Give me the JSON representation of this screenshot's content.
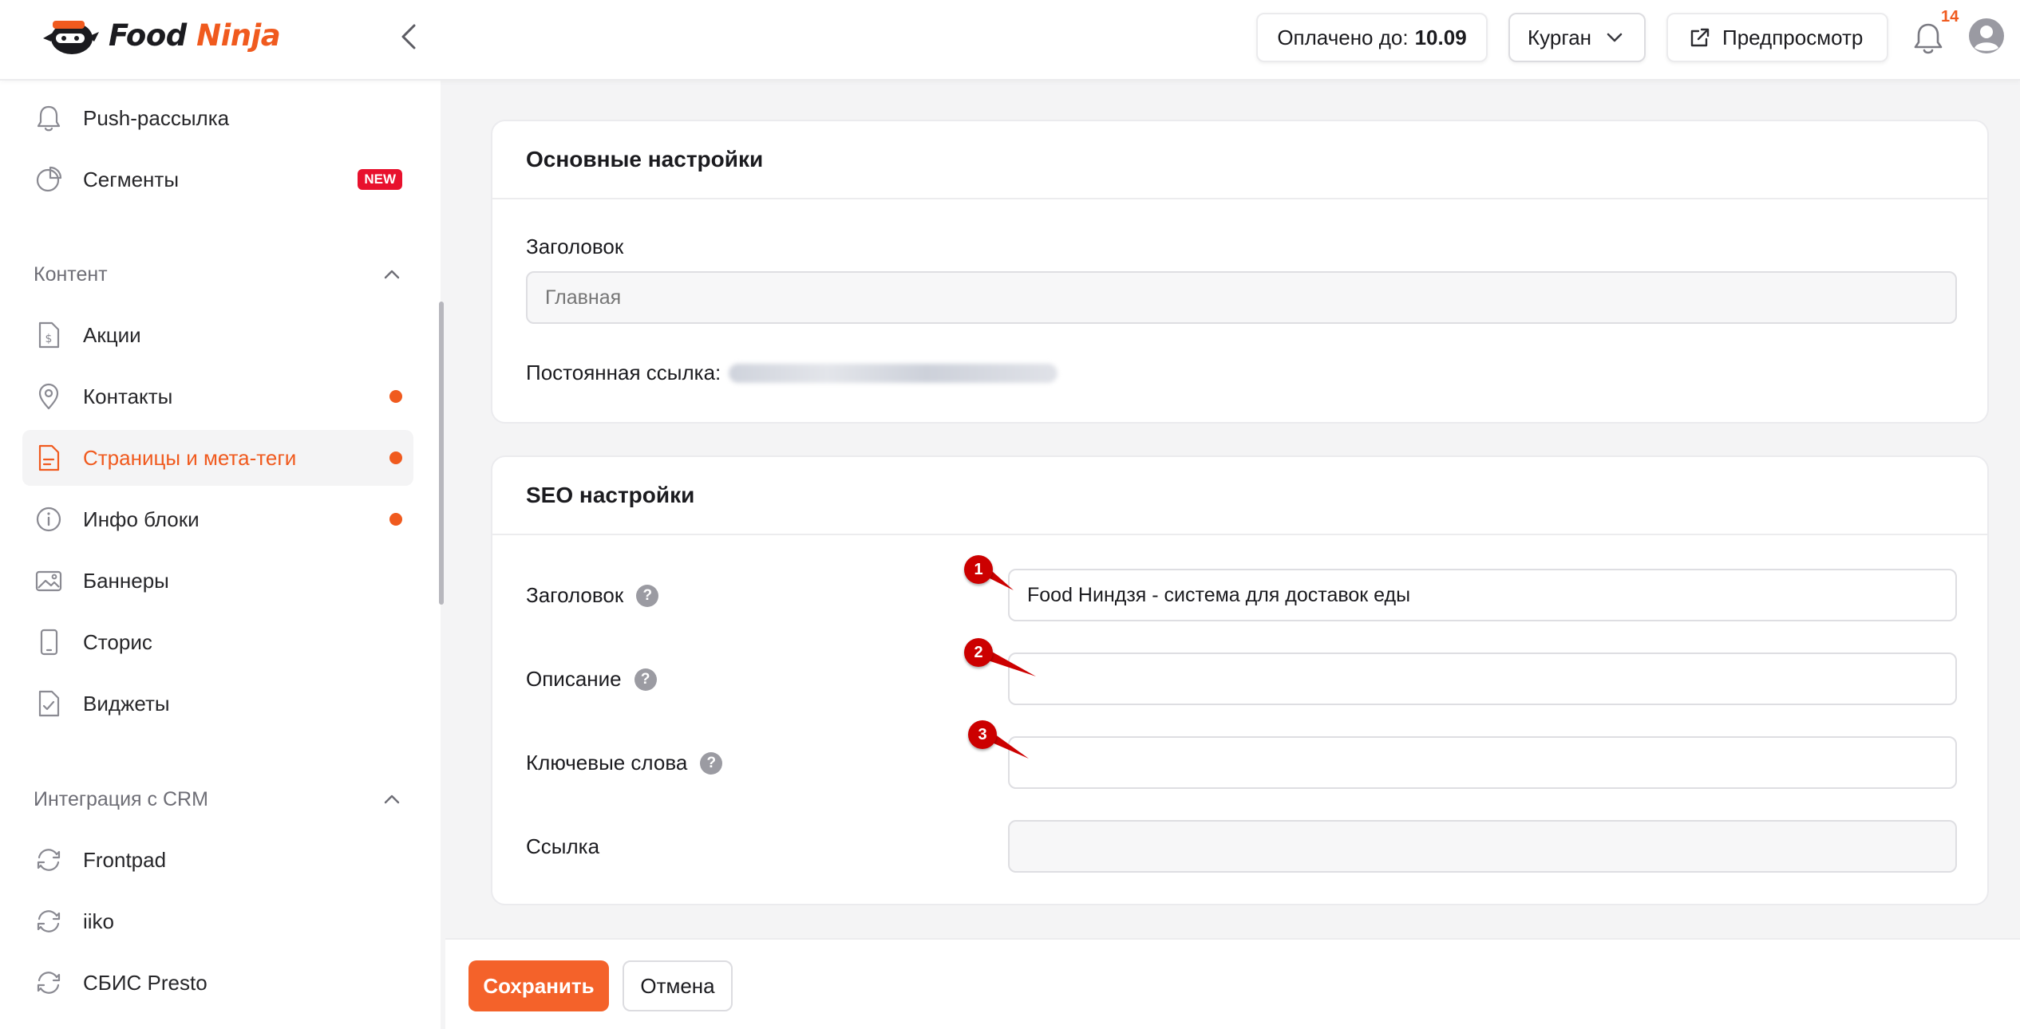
{
  "brand": {
    "food": "Food",
    "ninja": "Ninja"
  },
  "header": {
    "paid_label": "Оплачено до:",
    "paid_date": "10.09",
    "city": "Курган",
    "preview_label": "Предпросмотр",
    "notifications_count": "14"
  },
  "sidebar": {
    "items_top": [
      {
        "label": "Push-рассылка",
        "icon": "bell-icon"
      },
      {
        "label": "Сегменты",
        "icon": "pie-chart-icon",
        "badge": "NEW"
      }
    ],
    "content_section": "Контент",
    "content_items": [
      {
        "label": "Акции",
        "icon": "dollar-file-icon"
      },
      {
        "label": "Контакты",
        "icon": "map-pin-icon"
      },
      {
        "label": "Страницы и мета-теги",
        "icon": "document-icon"
      },
      {
        "label": "Инфо блоки",
        "icon": "info-icon"
      },
      {
        "label": "Баннеры",
        "icon": "image-icon"
      },
      {
        "label": "Сторис",
        "icon": "phone-icon"
      },
      {
        "label": "Виджеты",
        "icon": "check-file-icon"
      }
    ],
    "crm_section": "Интеграция с CRM",
    "crm_items": [
      {
        "label": "Frontpad",
        "icon": "sync-icon"
      },
      {
        "label": "iiko",
        "icon": "sync-icon"
      },
      {
        "label": "СБИС Presto",
        "icon": "sync-icon"
      }
    ]
  },
  "main_settings": {
    "title": "Основные настройки",
    "heading_label": "Заголовок",
    "heading_placeholder": "Главная",
    "permalink_label": "Постоянная ссылка:"
  },
  "seo_settings": {
    "title": "SEO настройки",
    "fields": [
      {
        "label": "Заголовок",
        "value": "Food Ниндзя - система для доставок еды",
        "marker": "1"
      },
      {
        "label": "Описание",
        "value": "",
        "marker": "2"
      },
      {
        "label": "Ключевые слова",
        "value": "",
        "marker": "3"
      },
      {
        "label": "Ссылка",
        "value": ""
      }
    ],
    "help_glyph": "?"
  },
  "actions": {
    "save": "Сохранить",
    "cancel": "Отмена"
  },
  "colors": {
    "accent": "#f05a1e",
    "marker": "#cc0000",
    "new_badge": "#e8112d"
  }
}
